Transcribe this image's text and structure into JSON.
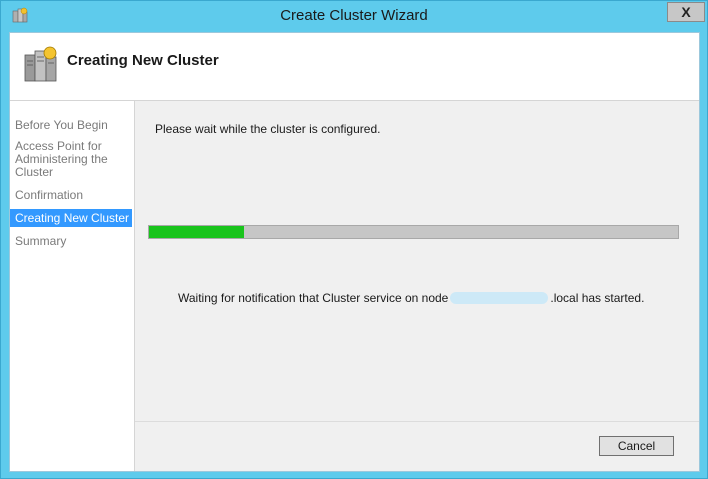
{
  "window": {
    "title": "Create Cluster Wizard",
    "close_label": "X"
  },
  "header": {
    "title": "Creating New Cluster",
    "icon": "cluster-servers-icon"
  },
  "nav": {
    "items": [
      {
        "label": "Before You Begin",
        "active": false
      },
      {
        "label": "Access Point for Administering the Cluster",
        "active": false
      },
      {
        "label": "Confirmation",
        "active": false
      },
      {
        "label": "Creating New Cluster",
        "active": true
      },
      {
        "label": "Summary",
        "active": false
      }
    ]
  },
  "main": {
    "wait_message": "Please wait while the cluster is configured.",
    "progress_fraction": 0.18,
    "status_prefix": "Waiting for notification that Cluster service on node",
    "status_suffix": ".local has started."
  },
  "footer": {
    "cancel_label": "Cancel"
  },
  "colors": {
    "titlebar": "#5ecbec",
    "progress_fill": "#19c41c",
    "nav_active": "#3399ff"
  }
}
